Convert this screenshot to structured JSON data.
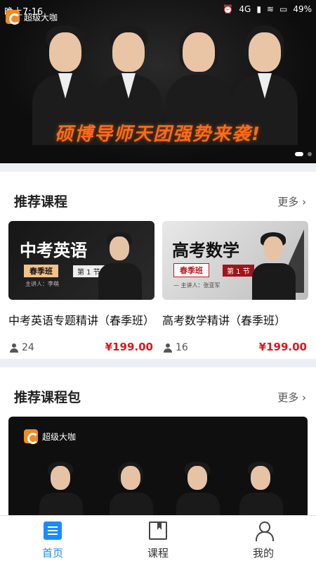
{
  "status_bar": {
    "time": "晚上7:16",
    "network": "4G",
    "battery": "49%"
  },
  "brand": {
    "name": "超级大咖"
  },
  "hero": {
    "slogan": "硕博导师天团强势来袭!"
  },
  "recommended_courses": {
    "title": "推荐课程",
    "more": "更多 ›",
    "items": [
      {
        "thumb_title": "中考英语",
        "thumb_tag": "春季班",
        "thumb_lesson": "第 1 节",
        "thumb_lecturer": "主讲人：李萌",
        "name": "中考英语专题精讲（春季班）",
        "students": "24",
        "price": "¥199.00"
      },
      {
        "thumb_title": "高考数学",
        "thumb_tag": "春季班",
        "thumb_lesson": "第 1 节",
        "thumb_lecturer": "— 主讲人：张亚军",
        "name": "高考数学精讲（春季班）",
        "students": "16",
        "price": "¥199.00"
      }
    ]
  },
  "recommended_packages": {
    "title": "推荐课程包",
    "more": "更多 ›",
    "brand": "超级大咖"
  },
  "tabbar": {
    "tabs": [
      {
        "label": "首页",
        "icon": "home-icon"
      },
      {
        "label": "课程",
        "icon": "book-icon"
      },
      {
        "label": "我的",
        "icon": "profile-icon"
      }
    ]
  }
}
